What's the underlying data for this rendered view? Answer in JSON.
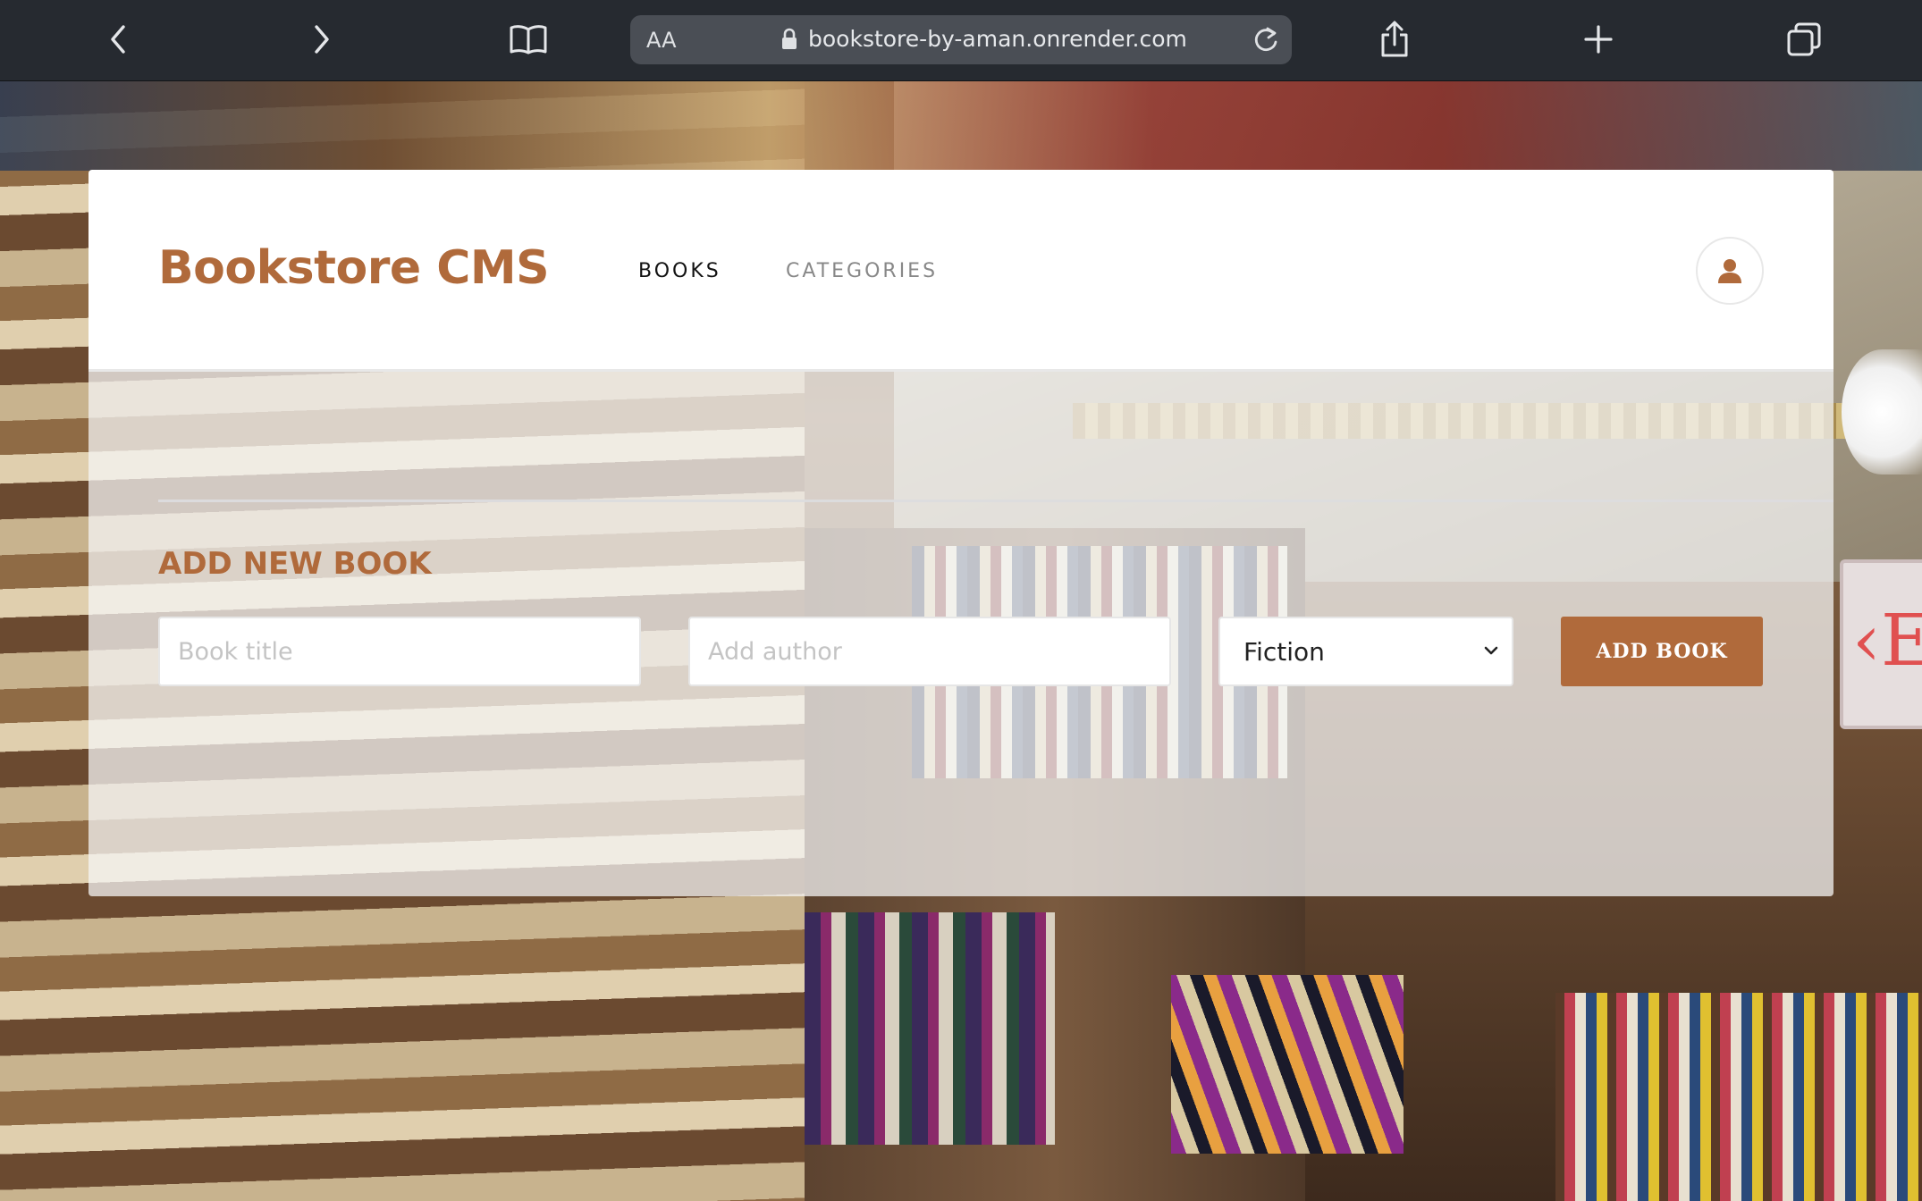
{
  "browser": {
    "text_size_label": "AA",
    "url": "bookstore-by-aman.onrender.com",
    "back_icon": "chevron-left-icon",
    "forward_icon": "chevron-right-icon",
    "bookmarks_icon": "book-open-icon",
    "share_icon": "share-icon",
    "new_tab_icon": "plus-icon",
    "tabs_icon": "tabs-icon",
    "reload_icon": "reload-icon",
    "lock_icon": "lock-icon"
  },
  "header": {
    "logo": "Bookstore CMS",
    "nav": [
      {
        "label": "BOOKS",
        "active": true
      },
      {
        "label": "CATEGORIES",
        "active": false
      }
    ],
    "user_icon": "user-icon"
  },
  "form": {
    "title": "ADD NEW BOOK",
    "title_placeholder": "Book title",
    "author_placeholder": "Add author",
    "category_selected": "Fiction",
    "submit_label": "ADD BOOK"
  },
  "colors": {
    "brand": "#b06a3b",
    "chrome_bg": "#262a30",
    "urlbar_bg": "#4a4e55",
    "nav_active": "#121212",
    "nav_inactive": "#888888"
  }
}
